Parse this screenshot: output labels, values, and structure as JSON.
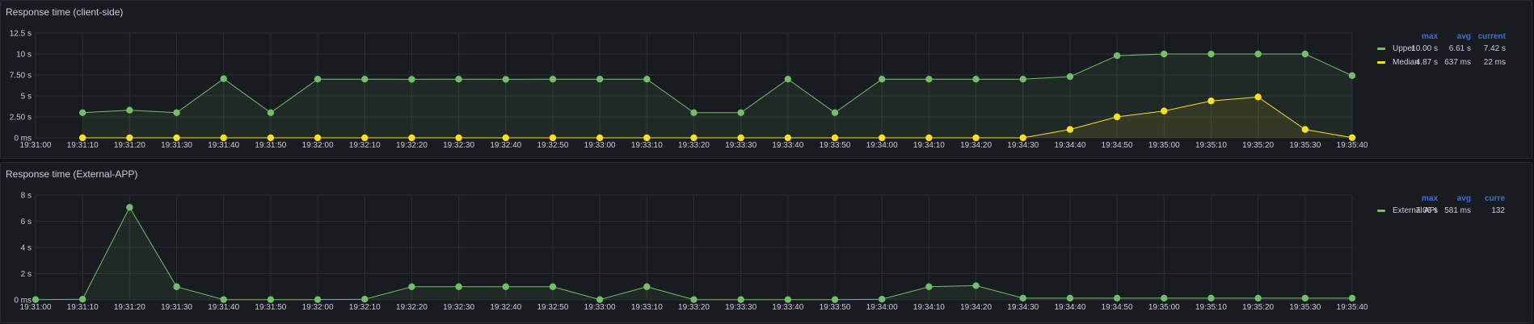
{
  "panels": [
    {
      "title": "Response time (client-side)",
      "legend": {
        "headers": [
          "max",
          "avg",
          "current"
        ],
        "rows": [
          {
            "name": "Upper",
            "color": "#73bf69",
            "max": "10.00 s",
            "avg": "6.61 s",
            "current": "7.42 s"
          },
          {
            "name": "Median",
            "color": "#fade2a",
            "max": "4.87 s",
            "avg": "637 ms",
            "current": "22 ms"
          }
        ]
      }
    },
    {
      "title": "Response time (External-APP)",
      "legend": {
        "headers": [
          "max",
          "avg",
          "curre"
        ],
        "rows": [
          {
            "name": "External API",
            "color": "#73bf69",
            "max": "7.06 s",
            "avg": "581 ms",
            "current": "132"
          }
        ]
      }
    }
  ],
  "chart_data": [
    {
      "type": "line",
      "title": "Response time (client-side)",
      "unit": "s",
      "x": [
        "19:31:00",
        "19:31:10",
        "19:31:20",
        "19:31:30",
        "19:31:40",
        "19:31:50",
        "19:32:00",
        "19:32:10",
        "19:32:20",
        "19:32:30",
        "19:32:40",
        "19:32:50",
        "19:33:00",
        "19:33:10",
        "19:33:20",
        "19:33:30",
        "19:33:40",
        "19:33:50",
        "19:34:00",
        "19:34:10",
        "19:34:20",
        "19:34:30",
        "19:34:40",
        "19:34:50",
        "19:35:00",
        "19:35:10",
        "19:35:20",
        "19:35:30",
        "19:35:40"
      ],
      "yticks": [
        "0 ms",
        "2.50 s",
        "5 s",
        "7.50 s",
        "10 s",
        "12.5 s"
      ],
      "ylim": [
        0,
        12.5
      ],
      "series": [
        {
          "name": "Upper",
          "color": "#73bf69",
          "x_start_index": 1,
          "values": [
            3.0,
            3.3,
            3.0,
            7.05,
            3.0,
            7.0,
            7.0,
            6.98,
            7.0,
            6.98,
            7.0,
            7.0,
            7.0,
            3.0,
            3.0,
            7.0,
            3.0,
            7.0,
            7.0,
            7.0,
            7.0,
            7.3,
            9.8,
            10.0,
            10.0,
            10.0,
            10.0,
            7.42
          ]
        },
        {
          "name": "Median",
          "color": "#fade2a",
          "x_start_index": 1,
          "values": [
            0,
            0,
            0,
            0,
            0,
            0,
            0,
            0,
            0,
            0,
            0,
            0,
            0,
            0,
            0,
            0,
            0,
            0,
            0,
            0,
            0,
            1.0,
            2.5,
            3.2,
            4.4,
            4.87,
            1.0,
            0.022
          ]
        }
      ]
    },
    {
      "type": "line",
      "title": "Response time (External-APP)",
      "unit": "s",
      "x": [
        "19:31:00",
        "19:31:10",
        "19:31:20",
        "19:31:30",
        "19:31:40",
        "19:31:50",
        "19:32:00",
        "19:32:10",
        "19:32:20",
        "19:32:30",
        "19:32:40",
        "19:32:50",
        "19:33:00",
        "19:33:10",
        "19:33:20",
        "19:33:30",
        "19:33:40",
        "19:33:50",
        "19:34:00",
        "19:34:10",
        "19:34:20",
        "19:34:30",
        "19:34:40",
        "19:34:50",
        "19:35:00",
        "19:35:10",
        "19:35:20",
        "19:35:30",
        "19:35:40"
      ],
      "yticks": [
        "0 ms",
        "2 s",
        "4 s",
        "6 s",
        "8 s"
      ],
      "ylim": [
        0,
        8
      ],
      "series": [
        {
          "name": "External API",
          "color": "#73bf69",
          "x_start_index": 0,
          "values": [
            0.02,
            0.05,
            7.06,
            1.0,
            0.02,
            0.02,
            0.02,
            0.05,
            1.0,
            1.0,
            1.0,
            1.0,
            0.02,
            1.0,
            0.02,
            0.02,
            0.02,
            0.02,
            0.05,
            1.0,
            1.08,
            0.13,
            0.13,
            0.13,
            0.13,
            0.13,
            0.13,
            0.13,
            0.13
          ]
        }
      ]
    }
  ]
}
